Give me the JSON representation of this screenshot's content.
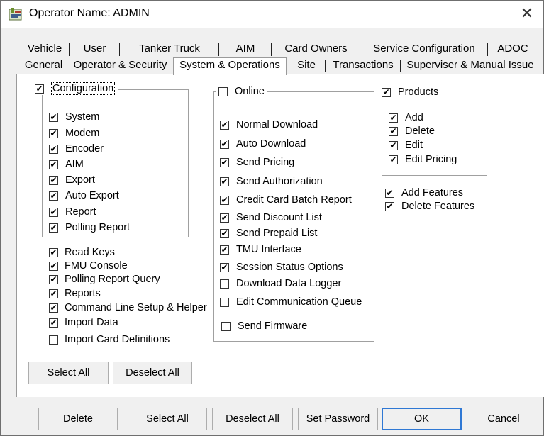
{
  "window": {
    "title": "Operator Name: ADMIN",
    "close_glyph": "✕",
    "icon": "app-icon"
  },
  "tabs_row1": [
    {
      "label": "Vehicle"
    },
    {
      "label": "User"
    },
    {
      "label": "Tanker Truck"
    },
    {
      "label": "AIM"
    },
    {
      "label": "Card Owners"
    },
    {
      "label": "Service Configuration"
    },
    {
      "label": "ADOC"
    }
  ],
  "tabs_row2": [
    {
      "label": "General"
    },
    {
      "label": "Operator & Security"
    },
    {
      "label": "System & Operations",
      "active": true
    },
    {
      "label": "Site"
    },
    {
      "label": "Transactions"
    },
    {
      "label": "Superviser & Manual Issue"
    }
  ],
  "configuration": {
    "label": "Configuration",
    "checked": true,
    "items": [
      {
        "label": "System",
        "checked": true
      },
      {
        "label": "Modem",
        "checked": true
      },
      {
        "label": "Encoder",
        "checked": true
      },
      {
        "label": "AIM",
        "checked": true
      },
      {
        "label": "Export",
        "checked": true
      },
      {
        "label": "Auto Export",
        "checked": true
      },
      {
        "label": "Report",
        "checked": true
      },
      {
        "label": "Polling Report",
        "checked": true
      }
    ]
  },
  "misc_items": [
    {
      "label": "Read Keys",
      "checked": true
    },
    {
      "label": "FMU Console",
      "checked": true
    },
    {
      "label": "Polling Report Query",
      "checked": true
    },
    {
      "label": "Reports",
      "checked": true
    },
    {
      "label": "Command Line Setup & Helper",
      "checked": true
    },
    {
      "label": "Import Data",
      "checked": true
    },
    {
      "label": "Import Card Definitions",
      "checked": false
    }
  ],
  "online": {
    "label": "Online",
    "checked": false,
    "items": [
      {
        "label": "Normal Download",
        "checked": true
      },
      {
        "label": "Auto Download",
        "checked": true
      },
      {
        "label": "Send Pricing",
        "checked": true
      },
      {
        "label": "Send Authorization",
        "checked": true
      },
      {
        "label": "Credit Card Batch Report",
        "checked": true
      },
      {
        "label": "Send Discount List",
        "checked": true
      },
      {
        "label": "Send Prepaid List",
        "checked": true
      },
      {
        "label": "TMU Interface",
        "checked": true
      },
      {
        "label": "Session Status Options",
        "checked": true
      },
      {
        "label": "Download Data Logger",
        "checked": false
      },
      {
        "label": "Edit Communication Queue",
        "checked": false
      },
      {
        "label": "Send Firmware",
        "checked": false
      }
    ]
  },
  "products": {
    "label": "Products",
    "checked": true,
    "items": [
      {
        "label": "Add",
        "checked": true
      },
      {
        "label": "Delete",
        "checked": true
      },
      {
        "label": "Edit",
        "checked": true
      },
      {
        "label": "Edit Pricing",
        "checked": true
      }
    ]
  },
  "features": [
    {
      "label": "Add Features",
      "checked": true
    },
    {
      "label": "Delete Features",
      "checked": true
    }
  ],
  "panel_buttons": {
    "select_all": "Select All",
    "deselect_all": "Deselect All"
  },
  "footer_buttons": {
    "delete": "Delete",
    "select_all": "Select All",
    "deselect_all": "Deselect All",
    "set_password": "Set Password",
    "ok": "OK",
    "cancel": "Cancel"
  },
  "check_glyph": "✔"
}
